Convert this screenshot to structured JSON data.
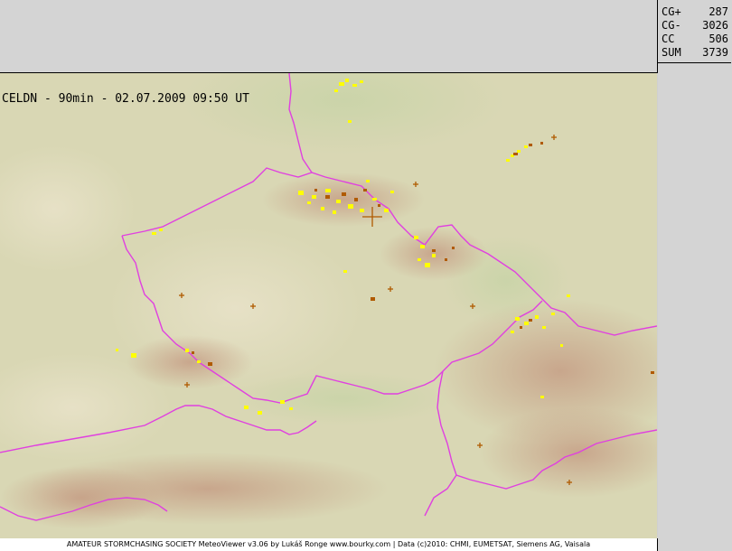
{
  "stats": {
    "rows": [
      {
        "label": "CG+",
        "value": "287"
      },
      {
        "label": "CG-",
        "value": "3026"
      },
      {
        "label": "CC",
        "value": "506"
      },
      {
        "label": "SUM",
        "value": "3739"
      }
    ]
  },
  "map": {
    "title": "CELDN - 90min - 02.07.2009 09:50 UT",
    "colors": {
      "border": "#e040e0",
      "strike_recent": "#ffff00",
      "strike_old": "#b05a00",
      "terrain": "#d9d7b4",
      "mountains": "#c49a82"
    }
  },
  "footer": {
    "text": "AMATEUR STORMCHASING SOCIETY MeteoViewer v3.06 by Lukáš Ronge www.bourky.com | Data (c)2010: CHMI, EUMETSAT, Siemens AG, Vaisala"
  }
}
